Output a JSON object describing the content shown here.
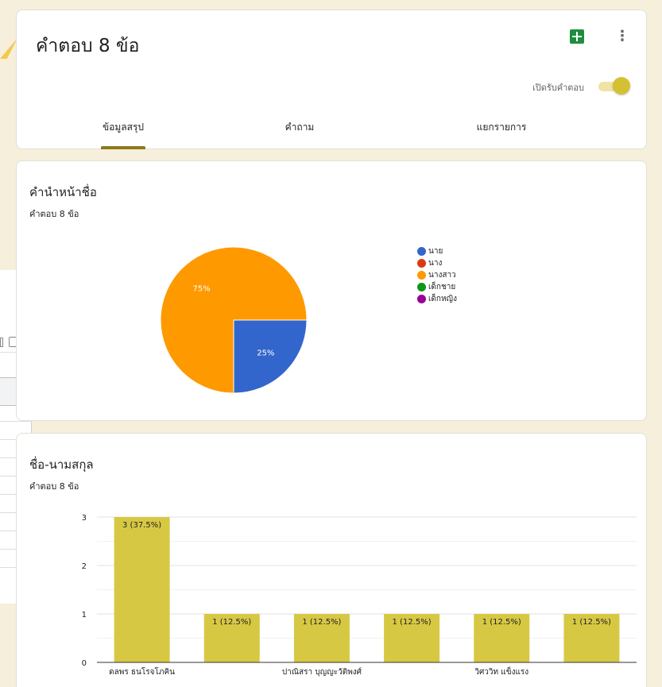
{
  "header": {
    "title": "คำตอบ 8 ข้อ",
    "accepting_label": "เปิดรับคำตอบ",
    "accepting": true,
    "icons": {
      "sheets": "sheets-icon",
      "more": "more-vert-icon"
    },
    "tabs": [
      {
        "label": "ข้อมูลสรุป",
        "active": true
      },
      {
        "label": "คำถาม",
        "active": false
      },
      {
        "label": "แยกรายการ",
        "active": false
      }
    ]
  },
  "questions": [
    {
      "title": "คำนำหน้าชื่อ",
      "response_count": "คำตอบ 8 ข้อ"
    },
    {
      "title": "ชื่อ-นามสกุล",
      "response_count": "คำตอบ 8 ข้อ"
    }
  ],
  "colors": {
    "accent": "#8d7a1b",
    "bar": "#d7c843"
  },
  "chart_data": [
    {
      "type": "pie",
      "categories": [
        "นาย",
        "นาง",
        "นางสาว",
        "เด็กชาย",
        "เด็กหญิง"
      ],
      "values": [
        25,
        0,
        75,
        0,
        0
      ],
      "colors": [
        "#3366cc",
        "#dc3912",
        "#ff9900",
        "#109618",
        "#990099"
      ],
      "labels": [
        "25%",
        "",
        "75%",
        "",
        ""
      ],
      "legend": "right"
    },
    {
      "type": "bar",
      "categories": [
        "ดลพร ธนโรจโภคิน",
        "",
        "ปาณิสรา บุญญะวัติพงศ์",
        "",
        "วิศววิท แข็งแรง",
        ""
      ],
      "values": [
        3,
        1,
        1,
        1,
        1,
        1
      ],
      "value_labels": [
        "3 (37.5%)",
        "1 (12.5%)",
        "1 (12.5%)",
        "1 (12.5%)",
        "1 (12.5%)",
        "1 (12.5%)"
      ],
      "ylim": [
        0,
        3
      ],
      "yticks": [
        "0",
        "1",
        "2",
        "3"
      ],
      "grid": true
    }
  ]
}
